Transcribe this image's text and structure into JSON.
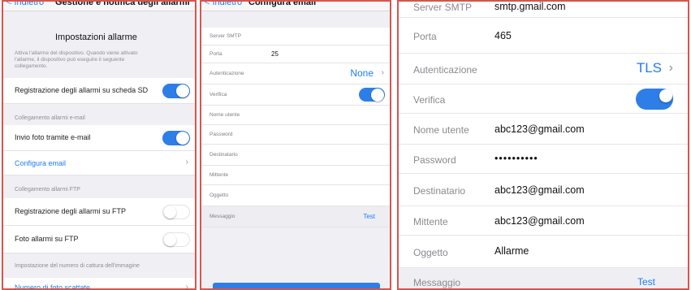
{
  "panel1": {
    "nav": {
      "back": "< Indietro",
      "title": "Gestione e notifica degli allarmi"
    },
    "header": "Impostazioni allarme",
    "desc_line1": "Attiva l'allarme del dispositivo. Quando viene attivato",
    "desc_line2": "l'allarme, il dispositivo può eseguire il seguente",
    "desc_line3": "collegamento.",
    "sd_label": "Registrazione degli allarmi su scheda SD",
    "sd_on": true,
    "email_section": "Collegamento allarmi e-mail",
    "email_photo_label": "Invio foto tramite e-mail",
    "email_photo_on": true,
    "configure_email": "Configura email",
    "ftp_section": "Collegamento allarmi FTP",
    "ftp_record_label": "Registrazione degli allarmi su FTP",
    "ftp_record_on": false,
    "ftp_photo_label": "Foto allarmi su FTP",
    "ftp_photo_on": false,
    "capture_section": "Impostazione del numero di cattura dell'immagine",
    "photo_count_label": "Numero di foto scattate"
  },
  "panel2": {
    "nav": {
      "back": "< Indietro",
      "title": "Configura email"
    },
    "server_label": "Server SMTP",
    "port_label": "Porta",
    "port_value": "25",
    "auth_label": "Autenticazione",
    "auth_value": "None",
    "verify_label": "Verifica",
    "verify_on": true,
    "username_label": "Nome utente",
    "password_label": "Password",
    "recipient_label": "Destinatario",
    "sender_label": "Mittente",
    "subject_label": "Oggetto",
    "message_label": "Messaggio",
    "test_label": "Test"
  },
  "panel3": {
    "server_label": "Server SMTP",
    "server_value": "smtp.gmail.com",
    "port_label": "Porta",
    "port_value": "465",
    "auth_label": "Autenticazione",
    "auth_value": "TLS",
    "verify_label": "Verifica",
    "verify_on": true,
    "username_label": "Nome utente",
    "username_value": "abc123@gmail.com",
    "password_label": "Password",
    "password_value": "••••••••••",
    "recipient_label": "Destinatario",
    "recipient_value": "abc123@gmail.com",
    "sender_label": "Mittente",
    "sender_value": "abc123@gmail.com",
    "subject_label": "Oggetto",
    "subject_value": "Allarme",
    "message_label": "Messaggio",
    "test_label": "Test"
  },
  "colors": {
    "accent": "#1f7bf6",
    "toggle_on": "#2e7ee8",
    "frame": "#d9534f"
  }
}
